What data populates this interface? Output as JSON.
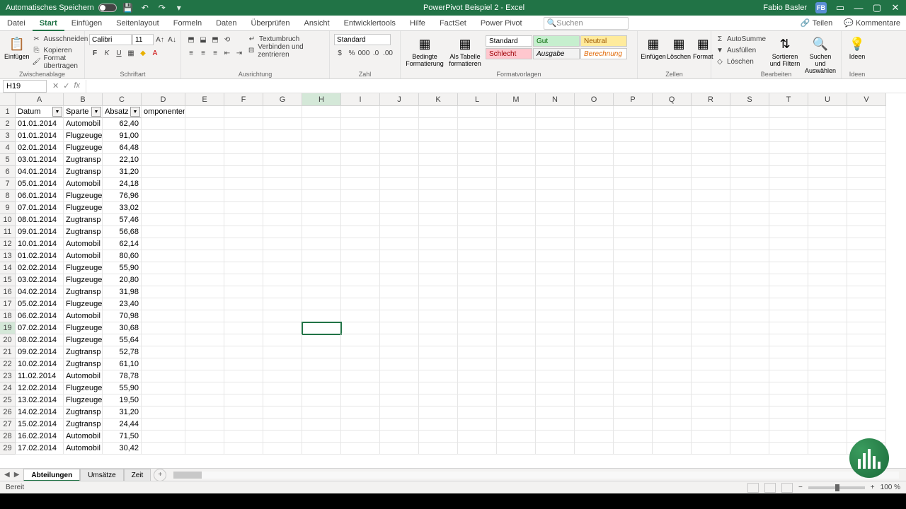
{
  "titlebar": {
    "autosave_label": "Automatisches Speichern",
    "title": "PowerPivot Beispiel 2 - Excel",
    "user_name": "Fabio Basler",
    "user_initials": "FB"
  },
  "tabs": {
    "items": [
      "Datei",
      "Start",
      "Einfügen",
      "Seitenlayout",
      "Formeln",
      "Daten",
      "Überprüfen",
      "Ansicht",
      "Entwicklertools",
      "Hilfe",
      "FactSet",
      "Power Pivot"
    ],
    "active": "Start",
    "search_placeholder": "Suchen",
    "share": "Teilen",
    "comments": "Kommentare"
  },
  "ribbon": {
    "clipboard": {
      "paste": "Einfügen",
      "cut": "Ausschneiden",
      "copy": "Kopieren",
      "format": "Format übertragen",
      "label": "Zwischenablage"
    },
    "font": {
      "name": "Calibri",
      "size": "11",
      "label": "Schriftart"
    },
    "align": {
      "wrap": "Textumbruch",
      "merge": "Verbinden und zentrieren",
      "label": "Ausrichtung"
    },
    "number": {
      "format": "Standard",
      "label": "Zahl"
    },
    "styles": {
      "cond": "Bedingte Formatierung",
      "table": "Als Tabelle formatieren",
      "s1": "Standard",
      "s2": "Gut",
      "s3": "Neutral",
      "s4": "Schlecht",
      "s5": "Ausgabe",
      "s6": "Berechnung",
      "label": "Formatvorlagen"
    },
    "cells": {
      "insert": "Einfügen",
      "delete": "Löschen",
      "format": "Format",
      "label": "Zellen"
    },
    "editing": {
      "sum": "AutoSumme",
      "fill": "Ausfüllen",
      "clear": "Löschen",
      "sort": "Sortieren und Filtern",
      "find": "Suchen und Auswählen",
      "label": "Bearbeiten"
    },
    "ideas": {
      "lbl": "Ideen",
      "label": "Ideen"
    }
  },
  "fbar": {
    "namebox": "H19"
  },
  "columns": [
    "A",
    "B",
    "C",
    "D",
    "E",
    "F",
    "G",
    "H",
    "I",
    "J",
    "K",
    "L",
    "M",
    "N",
    "O",
    "P",
    "Q",
    "R",
    "S",
    "T",
    "U",
    "V"
  ],
  "headers": {
    "a": "Datum",
    "b": "Sparte",
    "c": "Absatz k",
    "d": "omponenten"
  },
  "rows": [
    {
      "n": 2,
      "a": "01.01.2014",
      "b": "Automobil",
      "c": "62,40"
    },
    {
      "n": 3,
      "a": "01.01.2014",
      "b": "Flugzeuge",
      "c": "91,00"
    },
    {
      "n": 4,
      "a": "02.01.2014",
      "b": "Flugzeuge",
      "c": "64,48"
    },
    {
      "n": 5,
      "a": "03.01.2014",
      "b": "Zugtransp",
      "c": "22,10"
    },
    {
      "n": 6,
      "a": "04.01.2014",
      "b": "Zugtransp",
      "c": "31,20"
    },
    {
      "n": 7,
      "a": "05.01.2014",
      "b": "Automobil",
      "c": "24,18"
    },
    {
      "n": 8,
      "a": "06.01.2014",
      "b": "Flugzeuge",
      "c": "76,96"
    },
    {
      "n": 9,
      "a": "07.01.2014",
      "b": "Flugzeuge",
      "c": "33,02"
    },
    {
      "n": 10,
      "a": "08.01.2014",
      "b": "Zugtransp",
      "c": "57,46"
    },
    {
      "n": 11,
      "a": "09.01.2014",
      "b": "Zugtransp",
      "c": "56,68"
    },
    {
      "n": 12,
      "a": "10.01.2014",
      "b": "Automobil",
      "c": "62,14"
    },
    {
      "n": 13,
      "a": "01.02.2014",
      "b": "Automobil",
      "c": "80,60"
    },
    {
      "n": 14,
      "a": "02.02.2014",
      "b": "Flugzeuge",
      "c": "55,90"
    },
    {
      "n": 15,
      "a": "03.02.2014",
      "b": "Flugzeuge",
      "c": "20,80"
    },
    {
      "n": 16,
      "a": "04.02.2014",
      "b": "Zugtransp",
      "c": "31,98"
    },
    {
      "n": 17,
      "a": "05.02.2014",
      "b": "Flugzeuge",
      "c": "23,40"
    },
    {
      "n": 18,
      "a": "06.02.2014",
      "b": "Automobil",
      "c": "70,98"
    },
    {
      "n": 19,
      "a": "07.02.2014",
      "b": "Flugzeuge",
      "c": "30,68"
    },
    {
      "n": 20,
      "a": "08.02.2014",
      "b": "Flugzeuge",
      "c": "55,64"
    },
    {
      "n": 21,
      "a": "09.02.2014",
      "b": "Zugtransp",
      "c": "52,78"
    },
    {
      "n": 22,
      "a": "10.02.2014",
      "b": "Zugtransp",
      "c": "61,10"
    },
    {
      "n": 23,
      "a": "11.02.2014",
      "b": "Automobil",
      "c": "78,78"
    },
    {
      "n": 24,
      "a": "12.02.2014",
      "b": "Flugzeuge",
      "c": "55,90"
    },
    {
      "n": 25,
      "a": "13.02.2014",
      "b": "Flugzeuge",
      "c": "19,50"
    },
    {
      "n": 26,
      "a": "14.02.2014",
      "b": "Zugtransp",
      "c": "31,20"
    },
    {
      "n": 27,
      "a": "15.02.2014",
      "b": "Zugtransp",
      "c": "24,44"
    },
    {
      "n": 28,
      "a": "16.02.2014",
      "b": "Automobil",
      "c": "71,50"
    },
    {
      "n": 29,
      "a": "17.02.2014",
      "b": "Automobil",
      "c": "30,42"
    }
  ],
  "selected_cell": {
    "row": 19,
    "col": "H"
  },
  "sheets": {
    "items": [
      "Abteilungen",
      "Umsätze",
      "Zeit"
    ],
    "active": "Abteilungen"
  },
  "status": {
    "ready": "Bereit",
    "zoom": "100 %"
  }
}
